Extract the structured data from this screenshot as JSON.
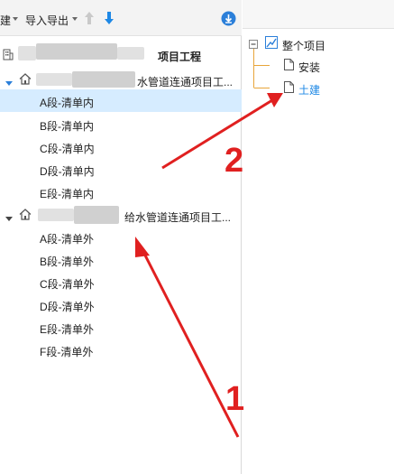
{
  "toolbar": {
    "new_label": "建",
    "import_export_label": "导入导出",
    "up_arrow_icon": "arrow-up-icon",
    "down_arrow_icon": "arrow-down-icon",
    "download_icon": "download-circle-icon"
  },
  "left_tree": {
    "root_label": "项目工程",
    "group1": {
      "title_suffix": "水管道连通项目工...",
      "items": [
        "A段-清单内",
        "B段-清单内",
        "C段-清单内",
        "D段-清单内",
        "E段-清单内"
      ],
      "selected_index": 0
    },
    "group2": {
      "title_suffix": "给水管道连通项目工...",
      "items": [
        "A段-清单外",
        "B段-清单外",
        "C段-清单外",
        "D段-清单外",
        "E段-清单外",
        "F段-清单外"
      ]
    }
  },
  "right_tree": {
    "root_label": "整个项目",
    "children": [
      "安装",
      "土建"
    ],
    "highlight_child": "土建"
  },
  "annotations": {
    "arrow1_number": "1",
    "arrow2_number": "2",
    "arrow_color": "#e02020"
  },
  "colors": {
    "selection": "#d6ecff",
    "accent_blue": "#1e88e5"
  }
}
